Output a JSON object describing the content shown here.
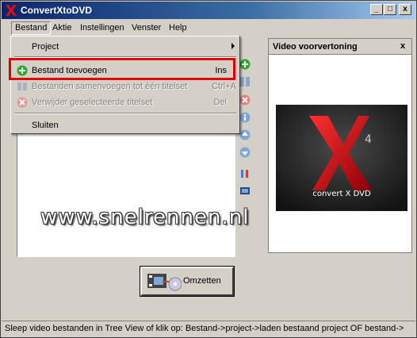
{
  "window": {
    "title": "ConvertXtoDVD",
    "minimize_glyph": "_",
    "maximize_glyph": "□",
    "close_glyph": "x"
  },
  "menubar": {
    "items": [
      {
        "label": "Bestand",
        "open": true
      },
      {
        "label": "Aktie"
      },
      {
        "label": "Instellingen"
      },
      {
        "label": "Venster"
      },
      {
        "label": "Help"
      }
    ]
  },
  "dropdown": {
    "items": [
      {
        "label": "Project",
        "submenu": true,
        "enabled": true
      },
      {
        "label": "Bestand toevoegen",
        "shortcut": "Ins",
        "icon": "add-icon",
        "enabled": true,
        "highlighted": true
      },
      {
        "label": "Bestanden samenvoegen tot één titelset",
        "shortcut": "Ctrl+A",
        "icon": "merge-icon",
        "enabled": false
      },
      {
        "label": "Verwijder geselecteerde titelset",
        "shortcut": "Del",
        "icon": "delete-icon",
        "enabled": false
      },
      {
        "label": "Sluiten",
        "enabled": true
      }
    ]
  },
  "preview": {
    "title": "Video voorvertoning",
    "close_glyph": "x",
    "logo_text": "convert X DVD"
  },
  "watermark": "www.snelrennen.nl",
  "convert_button": {
    "label": "Omzetten"
  },
  "status": {
    "text": "Sleep video bestanden in Tree View of klik op: Bestand->project->laden bestaand project OF bestand->"
  },
  "colors": {
    "titlebar_start": "#0a246a",
    "titlebar_end": "#a6caf0",
    "highlight": "#e00000",
    "face": "#d4d0c8"
  }
}
